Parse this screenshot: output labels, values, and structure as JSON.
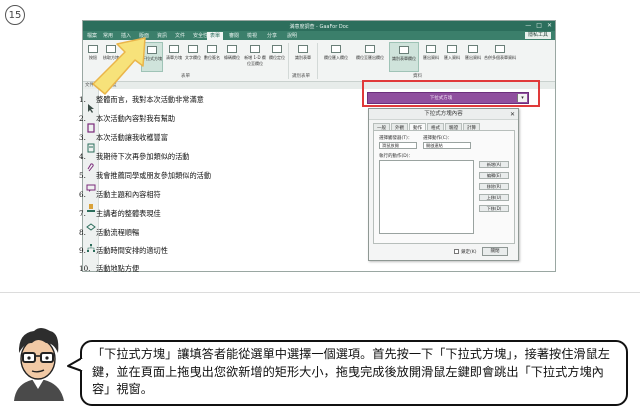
{
  "step_number": "15",
  "app": {
    "title": "満意度調查 - GaaFor Doc",
    "window_buttons": [
      "—",
      "□",
      "✕"
    ],
    "tabs": [
      "檔案",
      "常用",
      "插入",
      "版面",
      "資訊",
      "文件",
      "安全性",
      "表單",
      "審閱",
      "檢視",
      "分享",
      "說明"
    ],
    "active_tab": "表單",
    "tab_right_label": "隱私工具",
    "ribbon_buttons": [
      "按鈕",
      "核取方塊",
      "選項按鈕",
      "下拉式方塊",
      "清單方塊",
      "文字欄位",
      "數位簽名",
      "條碼欄位",
      "新增 1-D 欄位至欄位",
      "欄位定位",
      "識別表單",
      "欄位匯入欄位",
      "欄位至匯出欄位",
      "識別表單欄位",
      "匯出資料",
      "匯入資料",
      "匯出資料",
      "合併多個表單資料"
    ],
    "ribbon_groups": [
      "表單",
      "識別表單",
      "資料"
    ],
    "subbar_text": "文件名：滿意度"
  },
  "questions": [
    {
      "num": "1.",
      "text": "整體而言，我對本次活動非常滿意"
    },
    {
      "num": "2.",
      "text": "本次活動內容對我有幫助"
    },
    {
      "num": "3.",
      "text": "本次活動讓我收穫豐富"
    },
    {
      "num": "4.",
      "text": "我期待下次再參加類似的活動"
    },
    {
      "num": "5.",
      "text": "我會推薦同學或朋友參加類似的活動"
    },
    {
      "num": "6.",
      "text": "活動主題和內容相符"
    },
    {
      "num": "7.",
      "text": "主講者的整體表現佳"
    },
    {
      "num": "8.",
      "text": "活動流程順暢"
    },
    {
      "num": "9.",
      "text": "活動時間安排的適切性"
    },
    {
      "num": "10.",
      "text": "活動地點方便"
    }
  ],
  "dropdown_field": {
    "label": "下拉式方塊",
    "arrow": "▾"
  },
  "dialog": {
    "title": "下拉式方塊內容",
    "close": "✕",
    "tabs": [
      "一般",
      "外觀",
      "動作",
      "格式",
      "驗證",
      "計算"
    ],
    "active_tab": "動作",
    "trigger_label": "選擇觸發器(T)：",
    "action_label": "選擇動作(C)：",
    "trigger_value": "滑鼠放開",
    "action_value": "開啟連結",
    "list_label": "執行的動作(D)：",
    "side_buttons": [
      "新增(A)",
      "編輯(E)",
      "移除(R)",
      "上移(U)",
      "下移(D)"
    ],
    "lock_label": "鎖定(K)",
    "close_button": "關閉"
  },
  "caption": {
    "text": "「下拉式方塊」讓填答者能從選單中選擇一個選項。首先按一下「下拉式方塊」，接著按住滑鼠左鍵，並在頁面上拖曳出您欲新增的矩形大小，拖曳完成後放開滑鼠左鍵即會跳出「下拉式方塊內容」視窗。"
  },
  "colors": {
    "accent": "#2c6e5c",
    "highlight": "#e03a3a",
    "dropdown_fill": "#8f4f9e",
    "arrow_fill": "#f7e27a"
  }
}
